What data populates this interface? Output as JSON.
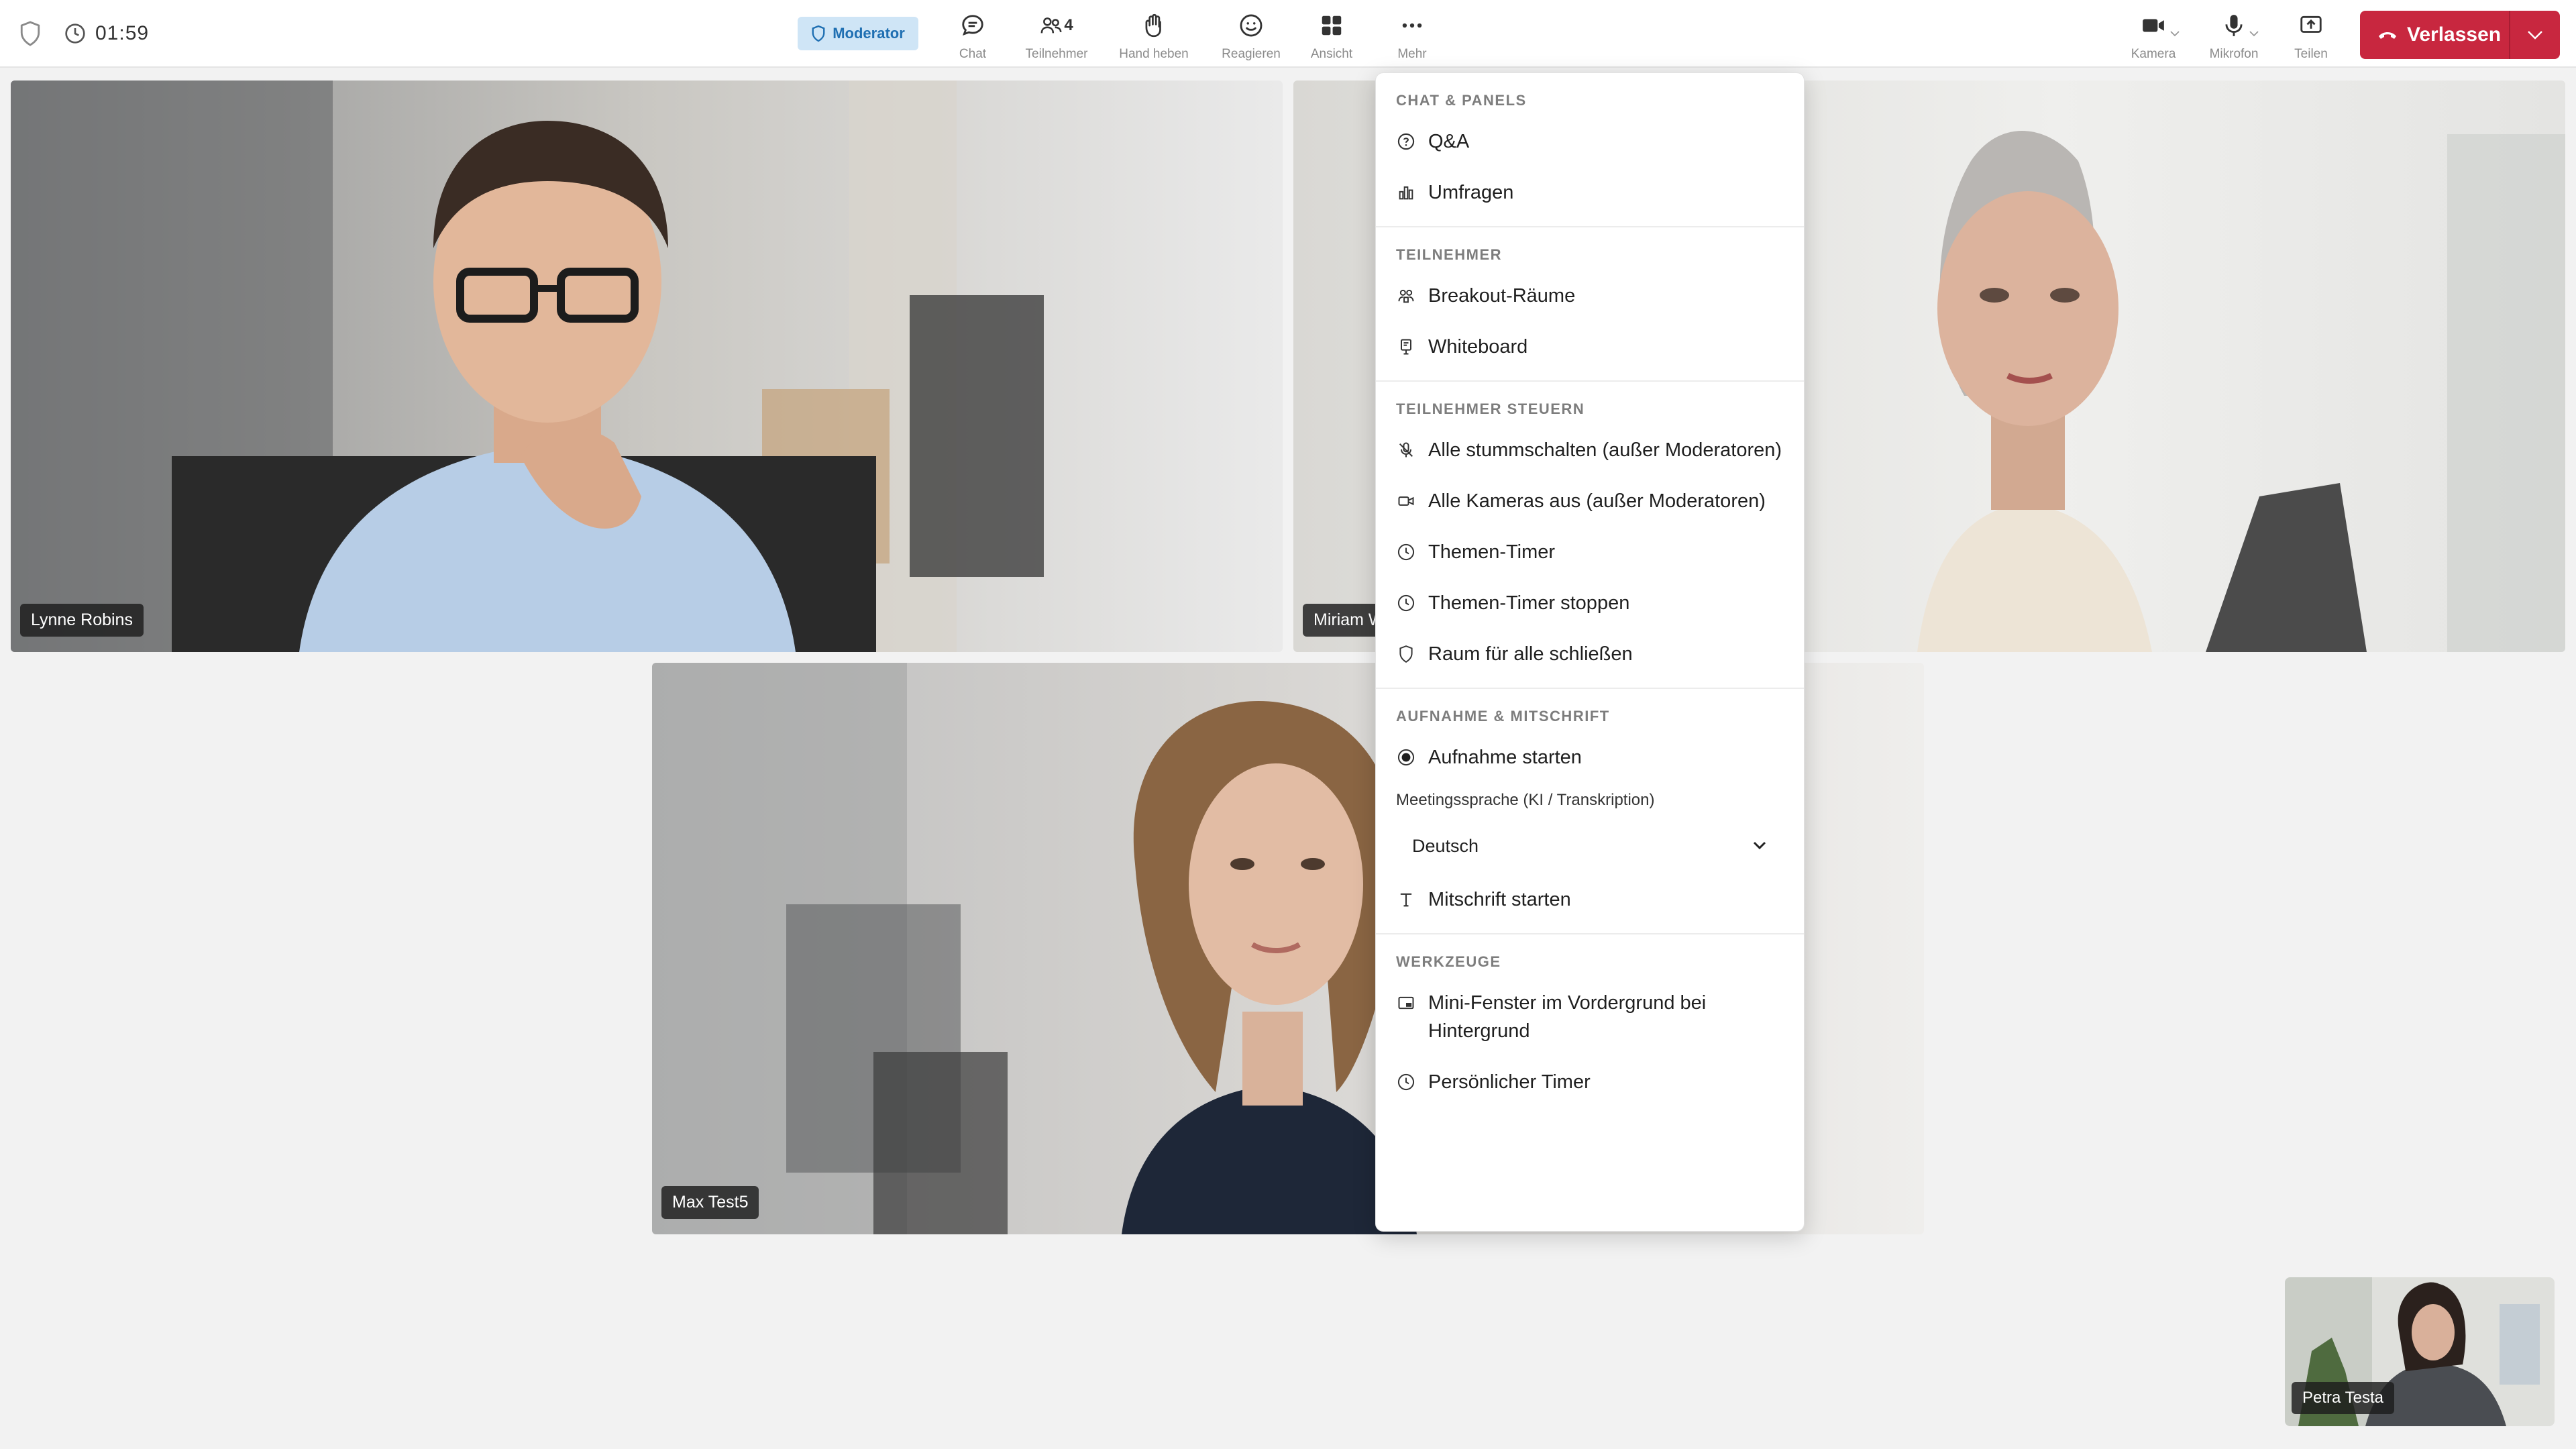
{
  "topbar": {
    "timer": "01:59",
    "role_badge": "Moderator",
    "buttons": {
      "chat": "Chat",
      "participants": "Teilnehmer",
      "participants_count": "4",
      "raise_hand": "Hand heben",
      "react": "Reagieren",
      "view": "Ansicht",
      "more": "Mehr",
      "camera": "Kamera",
      "microphone": "Mikrofon",
      "share": "Teilen"
    },
    "leave": "Verlassen",
    "colors": {
      "leave": "#c8273f",
      "badge_bg": "#cfe5f6",
      "badge_text": "#1f6fb2"
    }
  },
  "participants": [
    {
      "name": "Lynne Robins"
    },
    {
      "name": "Miriam W"
    },
    {
      "name": "Max Test5"
    },
    {
      "name": "Petra Testa"
    }
  ],
  "menu": {
    "sections": [
      {
        "heading": "CHAT & PANELS",
        "items": [
          "Q&A",
          "Umfragen"
        ]
      },
      {
        "heading": "TEILNEHMER",
        "items": [
          "Breakout-Räume",
          "Whiteboard"
        ]
      },
      {
        "heading": "TEILNEHMER STEUERN",
        "items": [
          "Alle stummschalten (außer Moderatoren)",
          "Alle Kameras aus (außer Moderatoren)",
          "Themen-Timer",
          "Themen-Timer stoppen",
          "Raum für alle schließen"
        ]
      },
      {
        "heading": "AUFNAHME & MITSCHRIFT",
        "items": [
          "Aufnahme starten",
          "Mitschrift starten"
        ],
        "language_label": "Meetingssprache (KI / Transkription)",
        "language_value": "Deutsch"
      },
      {
        "heading": "WERKZEUGE",
        "items": [
          "Mini-Fenster im Vordergrund bei Hintergrund",
          "Persönlicher Timer"
        ]
      }
    ]
  }
}
